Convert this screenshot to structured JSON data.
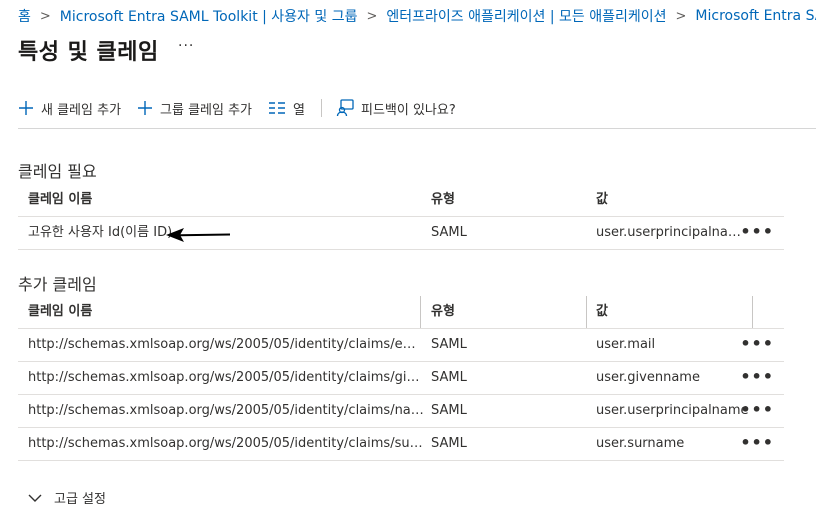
{
  "breadcrumb": {
    "items": [
      "홈",
      "Microsoft Entra SAML Toolkit | 사용자 및 그룹",
      "엔터프라이즈 애플리케이션 | 모든 애플리케이션",
      "Microsoft Entra SAML Toolkit"
    ],
    "separator": ">"
  },
  "page": {
    "title": "특성 및 클레임",
    "more": "···"
  },
  "toolbar": {
    "add_new_claim": "새 클레임 추가",
    "add_group_claim": "그룹 클레임 추가",
    "columns": "열",
    "feedback": "피드백이 있나요?"
  },
  "required_claims": {
    "title": "클레임 필요",
    "headers": {
      "name": "클레임 이름",
      "type": "유형",
      "value": "값"
    },
    "rows": [
      {
        "name": "고유한 사용자 Id(이름 ID)",
        "type": "SAML",
        "value": "user.userprincipalname ..."
      }
    ]
  },
  "additional_claims": {
    "title": "추가 클레임",
    "headers": {
      "name": "클레임 이름",
      "type": "유형",
      "value": "값"
    },
    "rows": [
      {
        "name": "http://schemas.xmlsoap.org/ws/2005/05/identity/claims/emailad...",
        "type": "SAML",
        "value": "user.mail"
      },
      {
        "name": "http://schemas.xmlsoap.org/ws/2005/05/identity/claims/givenna...",
        "type": "SAML",
        "value": "user.givenname"
      },
      {
        "name": "http://schemas.xmlsoap.org/ws/2005/05/identity/claims/name",
        "type": "SAML",
        "value": "user.userprincipalname"
      },
      {
        "name": "http://schemas.xmlsoap.org/ws/2005/05/identity/claims/surname",
        "type": "SAML",
        "value": "user.surname"
      }
    ]
  },
  "row_more": "•••",
  "advanced_settings": {
    "label": "고급 설정"
  },
  "colors": {
    "accent": "#0067b8",
    "text": "#323130",
    "divider": "#e1dfdd"
  }
}
